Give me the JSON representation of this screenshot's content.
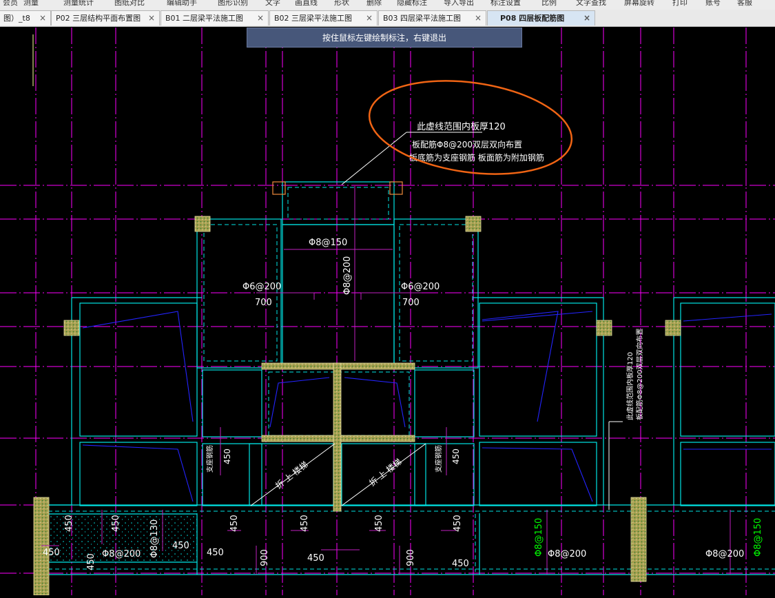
{
  "menubar": {
    "items": [
      "会员",
      "测量",
      "测量统计",
      "图纸对比",
      "编辑助手",
      "图形识别",
      "文字",
      "画直线",
      "形状",
      "删除",
      "隐藏标注",
      "导入导出",
      "标注设置",
      "比例",
      "文字查找",
      "屏幕旋转",
      "打印",
      "账号",
      "客服"
    ]
  },
  "tabs": [
    {
      "label": "图）_t8"
    },
    {
      "label": "P02 三层结构平面布置图"
    },
    {
      "label": "B01 二层梁平法施工图"
    },
    {
      "label": "B02 三层梁平法施工图"
    },
    {
      "label": "B03 四层梁平法施工图"
    },
    {
      "label": "P08 四层板配筋图"
    }
  ],
  "tab_close_glyph": "×",
  "hint": "按住鼠标左键绘制标注，右键退出",
  "drawing": {
    "annotation": {
      "line1": "此虚线范围内板厚120",
      "line2": "板配筋Φ8@200双层双向布置",
      "line3": "板底筋为支座钢筋 板面筋为附加钢筋"
    },
    "side_note": {
      "line1": "此虚线范围内板厚120",
      "line2": "板配筋Φ8@200双层双向布置"
    },
    "labels": {
      "top_rebar": "Φ8@150",
      "center_vertical": "Φ8@200",
      "left_rebar": "Φ6@200",
      "left_len": "700",
      "right_rebar": "Φ6@200",
      "right_len": "700",
      "stair_left": "折 上 楼梯",
      "stair_right": "折 上 楼梯",
      "stair_note_left": "支座钢筋",
      "stair_note_right": "支座钢筋",
      "v450_a": "450",
      "v450_b": "450",
      "b450_1": "450",
      "b450_2": "450",
      "b450_3": "450",
      "b450_4": "450",
      "b450_5": "450",
      "b450_6": "450",
      "b450_7": "450",
      "b450_8": "450",
      "b450_9": "450",
      "b450_10": "450",
      "b450_11": "450",
      "b450_12": "450",
      "b900_1": "900",
      "b900_2": "900",
      "rebar_130": "Φ8@130",
      "rebar_200_a": "Φ8@200",
      "rebar_150_a": "Φ8@150",
      "rebar_200_b": "Φ8@200",
      "rebar_200_c": "Φ8@200",
      "rebar_150_b": "Φ8@150"
    }
  },
  "colors": {
    "canvas": "#000000",
    "magenta_axis": "#ff00ff",
    "cyan_wall": "#00e5e5",
    "blue_rebar": "#2424ff",
    "markup_orange": "#f06414",
    "column_fill": "#a8a050",
    "hint_bg": "#47577a",
    "yellow_line": "#ffff9a",
    "label_green": "#00ff00"
  }
}
